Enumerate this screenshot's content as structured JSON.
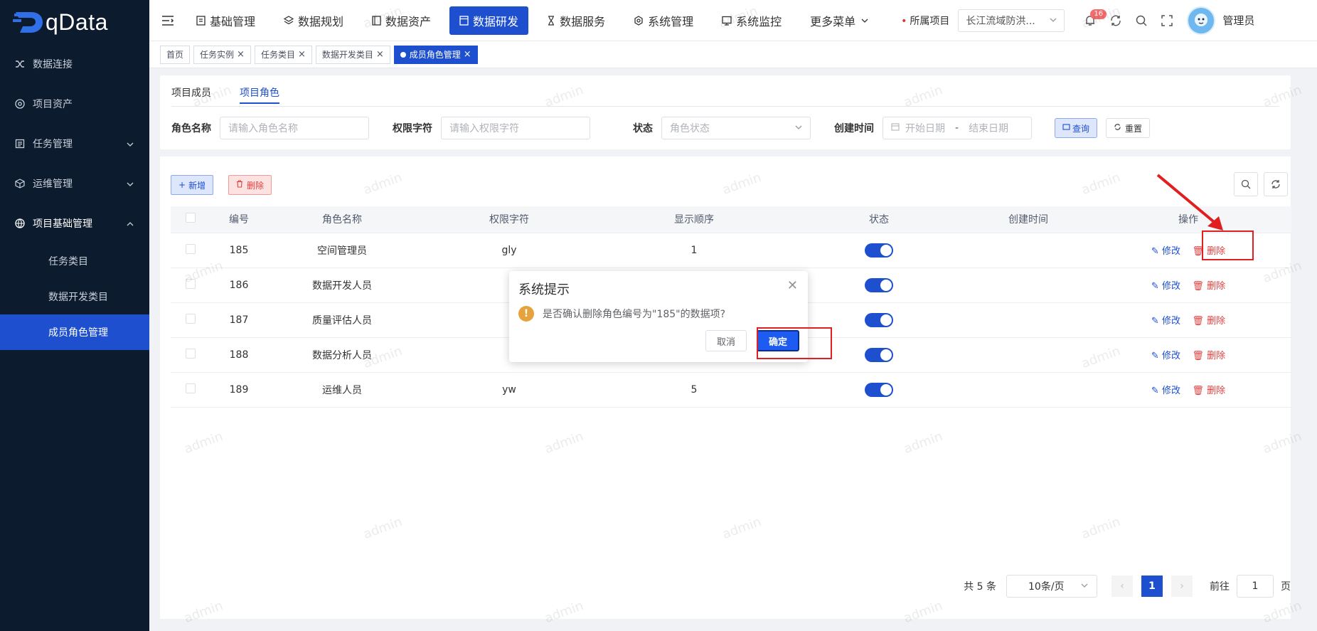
{
  "brand": {
    "name": "qData"
  },
  "sidebar": {
    "items": [
      {
        "label": "数据连接"
      },
      {
        "label": "项目资产"
      },
      {
        "label": "任务管理"
      },
      {
        "label": "运维管理"
      },
      {
        "label": "项目基础管理"
      }
    ],
    "subitems": [
      {
        "label": "任务类目"
      },
      {
        "label": "数据开发类目"
      },
      {
        "label": "成员角色管理"
      }
    ]
  },
  "topnav": {
    "tabs": [
      {
        "label": "基础管理"
      },
      {
        "label": "数据规划"
      },
      {
        "label": "数据资产"
      },
      {
        "label": "数据研发"
      },
      {
        "label": "数据服务"
      },
      {
        "label": "系统管理"
      },
      {
        "label": "系统监控"
      },
      {
        "label": "更多菜单"
      }
    ],
    "project_label": "所属项目",
    "project_value": "长江流域防洪...",
    "notification_count": "16",
    "username": "管理员"
  },
  "tagbar": {
    "tags": [
      {
        "label": "首页"
      },
      {
        "label": "任务实例"
      },
      {
        "label": "任务类目"
      },
      {
        "label": "数据开发类目"
      },
      {
        "label": "成员角色管理"
      }
    ]
  },
  "subtabs": [
    {
      "label": "项目成员"
    },
    {
      "label": "项目角色"
    }
  ],
  "filters": {
    "role_name_label": "角色名称",
    "role_name_placeholder": "请输入角色名称",
    "perm_label": "权限字符",
    "perm_placeholder": "请输入权限字符",
    "status_label": "状态",
    "status_placeholder": "角色状态",
    "time_label": "创建时间",
    "start_placeholder": "开始日期",
    "range_sep": "-",
    "end_placeholder": "结束日期",
    "query_label": "查询",
    "reset_label": "重置"
  },
  "toolbar": {
    "add_label": "新增",
    "delete_label": "删除"
  },
  "table": {
    "headers": [
      "编号",
      "角色名称",
      "权限字符",
      "显示顺序",
      "状态",
      "创建时间",
      "操作"
    ],
    "rows": [
      {
        "id": "185",
        "name": "空间管理员",
        "perm": "gly",
        "order": "1"
      },
      {
        "id": "186",
        "name": "数据开发人员",
        "perm": "",
        "order": ""
      },
      {
        "id": "187",
        "name": "质量评估人员",
        "perm": "",
        "order": ""
      },
      {
        "id": "188",
        "name": "数据分析人员",
        "perm": "",
        "order": ""
      },
      {
        "id": "189",
        "name": "运维人员",
        "perm": "yw",
        "order": "5"
      }
    ],
    "edit_label": "修改",
    "delete_label": "删除"
  },
  "pager": {
    "total": "共 5 条",
    "page_size": "10条/页",
    "current": "1",
    "goto_label": "前往",
    "goto_value": "1",
    "page_unit": "页"
  },
  "dialog": {
    "title": "系统提示",
    "message": "是否确认删除角色编号为\"185\"的数据项?",
    "cancel_label": "取消",
    "ok_label": "确定"
  },
  "watermark_text": "admin",
  "colors": {
    "primary": "#1e4fcf",
    "sidebar_bg": "#0d1b2e",
    "danger": "#e04040"
  }
}
